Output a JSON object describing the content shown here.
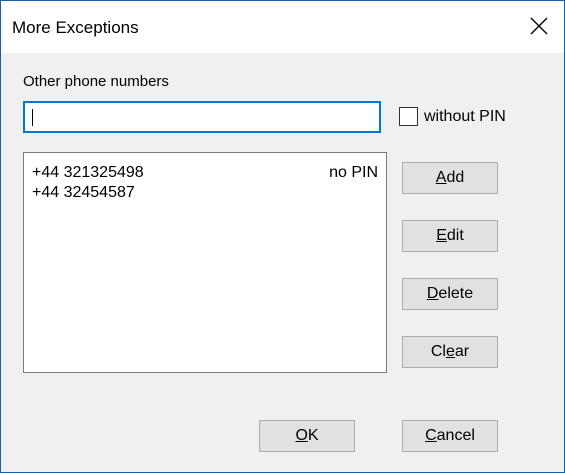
{
  "dialog": {
    "title": "More Exceptions"
  },
  "form": {
    "other_label": "Other phone numbers",
    "phone_input_value": "",
    "without_pin_label": "without PIN",
    "without_pin_checked": false
  },
  "list": {
    "rows": [
      {
        "number": "+44 321325498",
        "pin": "no PIN"
      },
      {
        "number": "+44 32454587",
        "pin": ""
      }
    ]
  },
  "buttons": {
    "add": {
      "mnemonic": "A",
      "rest": "dd"
    },
    "edit": {
      "mnemonic": "E",
      "rest": "dit"
    },
    "delete": {
      "mnemonic": "D",
      "rest": "elete"
    },
    "clear": {
      "pre": "Cl",
      "mnemonic": "e",
      "rest": "ar"
    },
    "ok": {
      "mnemonic": "O",
      "rest": "K"
    },
    "cancel": {
      "mnemonic": "C",
      "rest": "ancel"
    }
  }
}
